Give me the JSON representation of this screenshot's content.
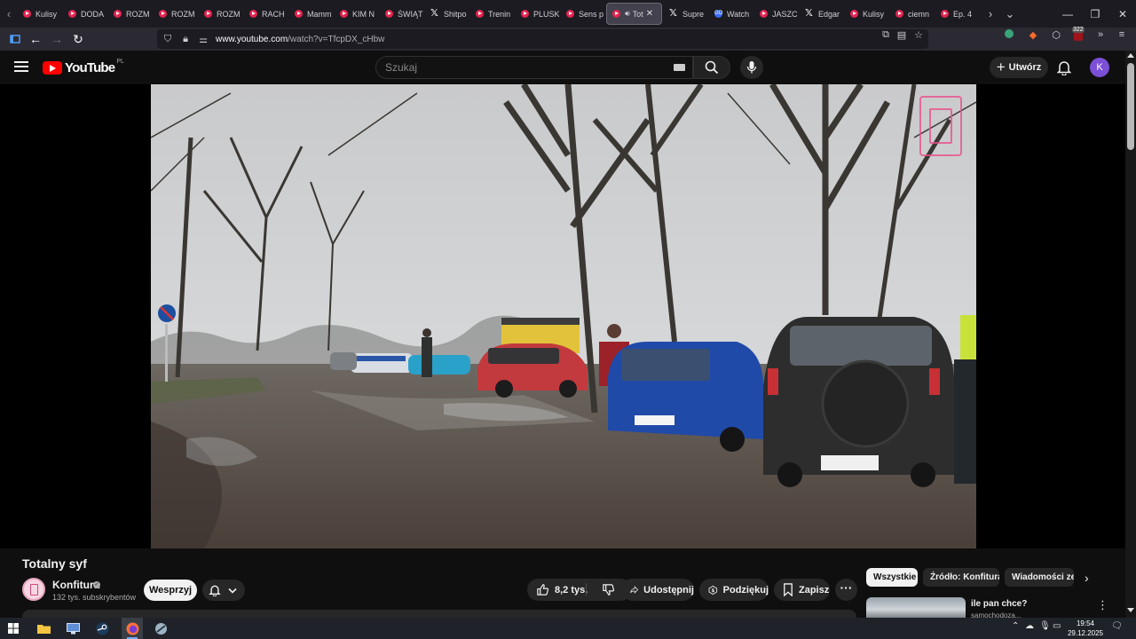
{
  "browser": {
    "tabs": [
      {
        "label": "Kulisy",
        "icon": "youtube-icon"
      },
      {
        "label": "DODA",
        "icon": "youtube-icon"
      },
      {
        "label": "ROZM",
        "icon": "youtube-icon"
      },
      {
        "label": "ROZM",
        "icon": "youtube-icon"
      },
      {
        "label": "ROZM",
        "icon": "youtube-icon"
      },
      {
        "label": "RACH",
        "icon": "youtube-icon"
      },
      {
        "label": "Mamm",
        "icon": "youtube-icon"
      },
      {
        "label": "KIM N",
        "icon": "youtube-icon"
      },
      {
        "label": "ŚWIĄT",
        "icon": "youtube-icon"
      },
      {
        "label": "Shitpo",
        "icon": "x-icon"
      },
      {
        "label": "Trenin",
        "icon": "youtube-icon"
      },
      {
        "label": "PLUSK",
        "icon": "youtube-icon"
      },
      {
        "label": "Sens p",
        "icon": "youtube-icon"
      },
      {
        "label": "Tot",
        "icon": "youtube-icon",
        "active": true
      },
      {
        "label": "Supre",
        "icon": "x-icon"
      },
      {
        "label": "Watch",
        "icon": "go-icon"
      },
      {
        "label": "JASZC",
        "icon": "youtube-icon"
      },
      {
        "label": "Edgar",
        "icon": "x-icon"
      },
      {
        "label": "Kulisy",
        "icon": "youtube-icon"
      },
      {
        "label": "ciemn",
        "icon": "youtube-icon"
      },
      {
        "label": "Ep. 4",
        "icon": "youtube-icon"
      }
    ],
    "url_domain": "www.youtube.com",
    "url_path": "/watch?v=TfcpDX_cHbw",
    "extension_badge": "322"
  },
  "youtube": {
    "logo_text": "YouTube",
    "country_code": "PL",
    "search_placeholder": "Szukaj",
    "create_label": "Utwórz",
    "avatar_letter": "K",
    "video": {
      "watermark_icon": "konfitura-logo-icon"
    },
    "title": "Totalny syf",
    "channel": {
      "name": "Konfitura",
      "subscribers": "132 tys. subskrybentów",
      "support_label": "Wesprzyj"
    },
    "actions": {
      "likes": "8,2 tys.",
      "share": "Udostępnij",
      "thanks": "Podziękuj",
      "save": "Zapisz"
    },
    "chips": [
      "Wszystkie",
      "Źródło: Konfitura",
      "Wiadomości ze ..."
    ],
    "recommendation": {
      "title": "ile pan chce?",
      "channel": "samochodoza..."
    }
  },
  "taskbar": {
    "time": "19:54",
    "date": "29.12.2025"
  },
  "colors": {
    "yt_bg": "#0f0f0f",
    "yt_red": "#ff0000",
    "browser_tabstrip": "#1c1b22",
    "browser_toolbar": "#2b2a33",
    "avatar": "#7b4fd6"
  }
}
